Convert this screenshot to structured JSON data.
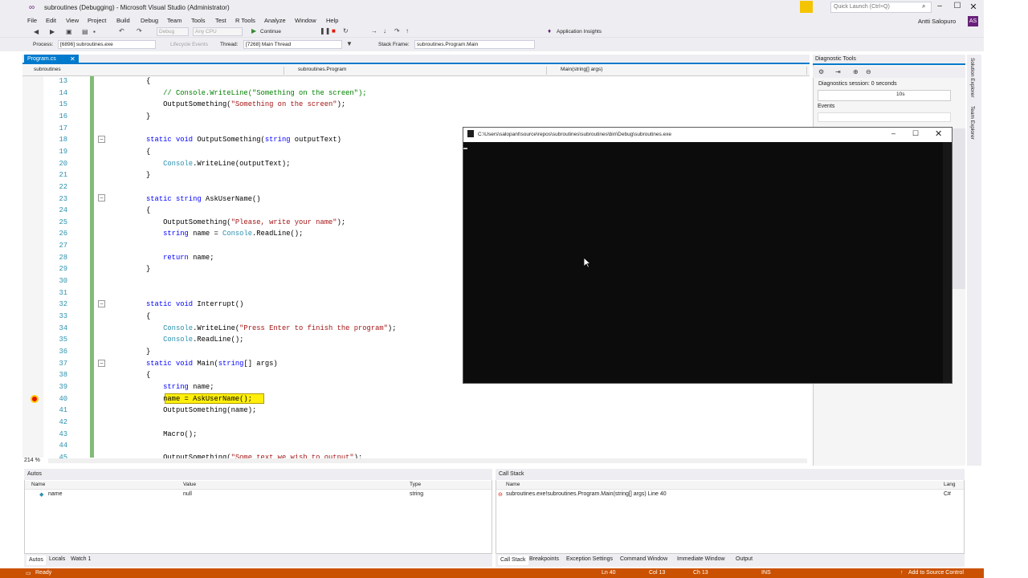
{
  "window": {
    "title": "subroutines (Debugging) - Microsoft Visual Studio  (Administrator)",
    "quick_launch_placeholder": "Quick Launch (Ctrl+Q)",
    "user_name": "Antti Salopuro",
    "user_initials": "AS"
  },
  "menu": [
    "File",
    "Edit",
    "View",
    "Project",
    "Build",
    "Debug",
    "Team",
    "Tools",
    "Test",
    "R Tools",
    "Analyze",
    "Window",
    "Help"
  ],
  "toolbar": {
    "config": "Debug",
    "platform": "Any CPU",
    "continue_label": "Continue",
    "app_insights": "Application Insights",
    "process_label": "Process:",
    "process_value": "[6896] subroutines.exe",
    "lifecycle_label": "Lifecycle Events",
    "thread_label": "Thread:",
    "thread_value": "[7268] Main Thread",
    "stackframe_label": "Stack Frame:",
    "stackframe_value": "subroutines.Program.Main"
  },
  "editor": {
    "tab": "Program.cs",
    "nav_project": "subroutines",
    "nav_class": "subroutines.Program",
    "nav_member": "Main(string[] args)",
    "zoom": "214 %",
    "lines": [
      {
        "n": "13",
        "code": "{"
      },
      {
        "n": "14",
        "code": "    // Console.WriteLine(\"Something on the screen\");"
      },
      {
        "n": "15",
        "code": "    OutputSomething(\"Something on the screen\");"
      },
      {
        "n": "16",
        "code": "}"
      },
      {
        "n": "17",
        "code": ""
      },
      {
        "n": "18",
        "code": "static void OutputSomething(string outputText)"
      },
      {
        "n": "19",
        "code": "{"
      },
      {
        "n": "20",
        "code": "    Console.WriteLine(outputText);"
      },
      {
        "n": "21",
        "code": "}"
      },
      {
        "n": "22",
        "code": ""
      },
      {
        "n": "23",
        "code": "static string AskUserName()"
      },
      {
        "n": "24",
        "code": "{"
      },
      {
        "n": "25",
        "code": "    OutputSomething(\"Please, write your name\");"
      },
      {
        "n": "26",
        "code": "    string name = Console.ReadLine();"
      },
      {
        "n": "27",
        "code": ""
      },
      {
        "n": "28",
        "code": "    return name;"
      },
      {
        "n": "29",
        "code": "}"
      },
      {
        "n": "30",
        "code": ""
      },
      {
        "n": "31",
        "code": ""
      },
      {
        "n": "32",
        "code": "static void Interrupt()"
      },
      {
        "n": "33",
        "code": "{"
      },
      {
        "n": "34",
        "code": "    Console.WriteLine(\"Press Enter to finish the program\");"
      },
      {
        "n": "35",
        "code": "    Console.ReadLine();"
      },
      {
        "n": "36",
        "code": "}"
      },
      {
        "n": "37",
        "code": "static void Main(string[] args)"
      },
      {
        "n": "38",
        "code": "{"
      },
      {
        "n": "39",
        "code": "    string name;"
      },
      {
        "n": "40",
        "code": "    name = AskUserName();"
      },
      {
        "n": "41",
        "code": "    OutputSomething(name);"
      },
      {
        "n": "42",
        "code": ""
      },
      {
        "n": "43",
        "code": "    Macro();"
      },
      {
        "n": "44",
        "code": ""
      },
      {
        "n": "45",
        "code": "    OutputSomething(\"Some text we wish to output\");"
      }
    ]
  },
  "console": {
    "title": "C:\\Users\\salopant\\source\\repos\\subroutines\\subroutines\\bin\\Debug\\subroutines.exe"
  },
  "diagnostics": {
    "title": "Diagnostic Tools",
    "session": "Diagnostics session: 0 seconds",
    "timeline_label": "10s",
    "events_label": "Events"
  },
  "side_tabs": [
    "Solution Explorer",
    "Team Explorer"
  ],
  "autos": {
    "title": "Autos",
    "columns": [
      "Name",
      "Value",
      "Type"
    ],
    "rows": [
      {
        "name": "name",
        "value": "null",
        "type": "string"
      }
    ],
    "tabs": [
      "Autos",
      "Locals",
      "Watch 1"
    ]
  },
  "callstack": {
    "title": "Call Stack",
    "columns": [
      "Name",
      "Lang"
    ],
    "rows": [
      {
        "name": "subroutines.exe!subroutines.Program.Main(string[] args) Line 40",
        "lang": "C#"
      }
    ],
    "tabs": [
      "Call Stack",
      "Breakpoints",
      "Exception Settings",
      "Command Window",
      "Immediate Window",
      "Output"
    ]
  },
  "status": {
    "ready": "Ready",
    "ln": "Ln 40",
    "col": "Col 13",
    "ch": "Ch 13",
    "ins": "INS",
    "source_control": "Add to Source Control"
  },
  "colors": {
    "accent": "#007acc",
    "debug_status": "#ca5100",
    "keyword": "#0000ff",
    "type": "#2b91af",
    "string": "#a31515",
    "comment": "#008000"
  }
}
